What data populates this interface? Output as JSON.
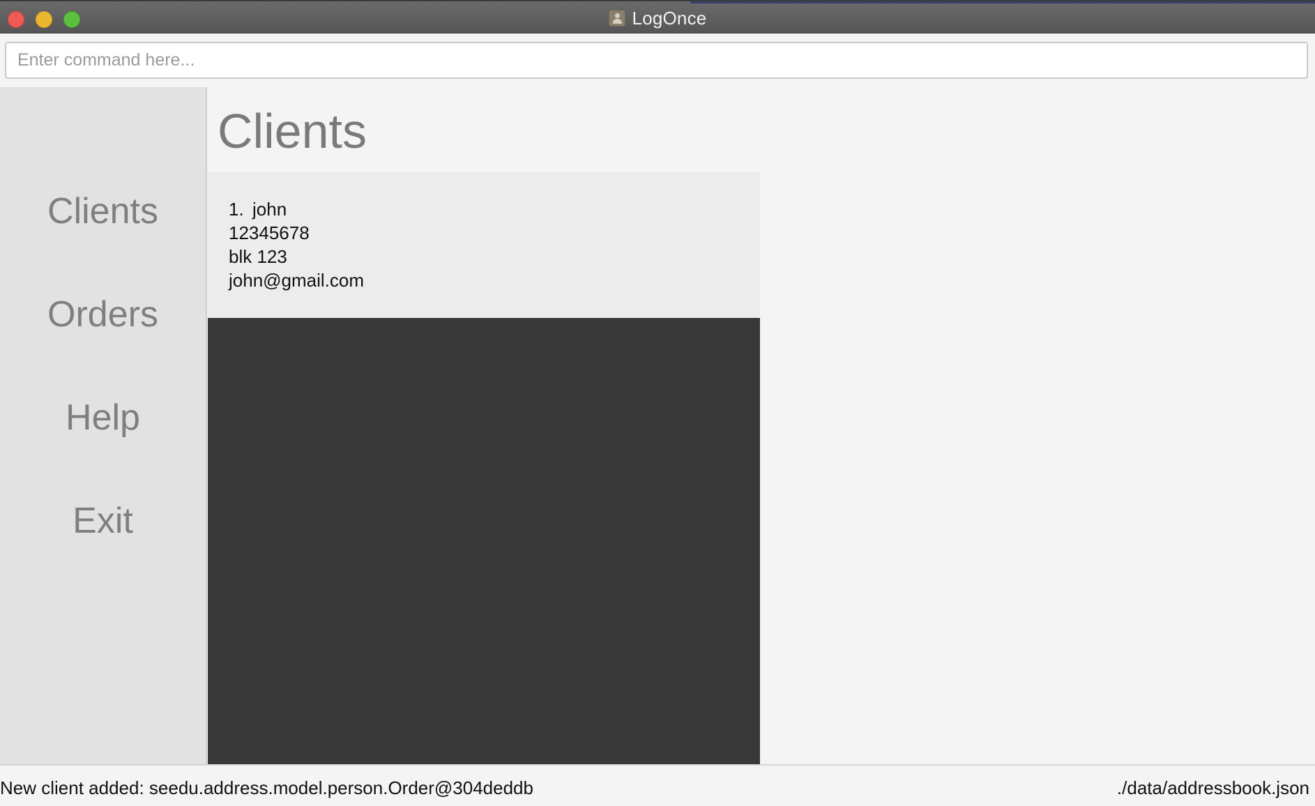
{
  "window": {
    "title": "LogOnce",
    "icon": "address-book-icon"
  },
  "command": {
    "placeholder": "Enter command here...",
    "value": ""
  },
  "sidebar": {
    "items": [
      {
        "label": "Clients"
      },
      {
        "label": "Orders"
      },
      {
        "label": "Help"
      },
      {
        "label": "Exit"
      }
    ]
  },
  "main": {
    "title": "Clients",
    "clients": [
      {
        "index": "1.",
        "name": "john",
        "phone": "12345678",
        "address": "blk 123",
        "email": "john@gmail.com"
      }
    ]
  },
  "status": {
    "message": "New client added: seedu.address.model.person.Order@304deddb",
    "file_path": "./data/addressbook.json"
  }
}
